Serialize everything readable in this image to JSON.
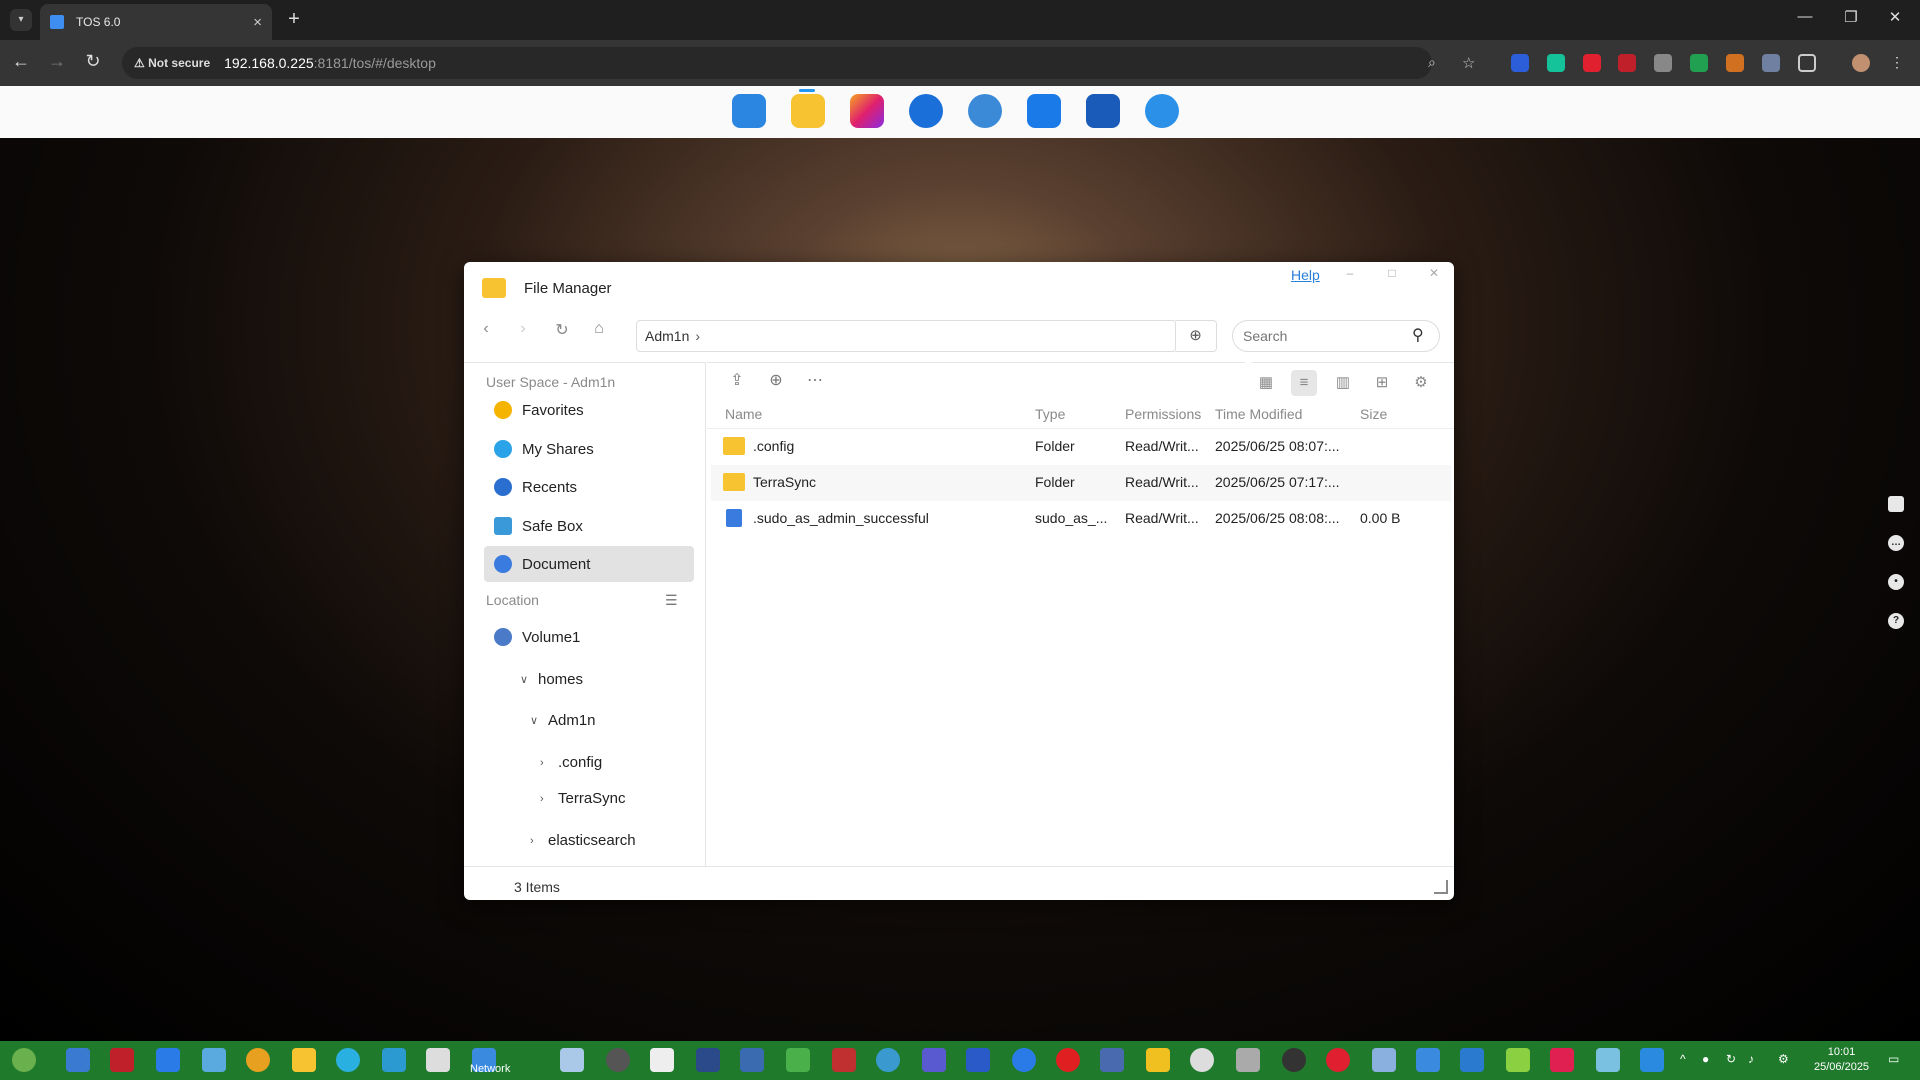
{
  "browser": {
    "tab_title": "TOS 6.0",
    "tab_close": "×",
    "new_tab": "+",
    "security_label": "Not secure",
    "url_host": "192.168.0.225",
    "url_path": ":8181/tos/#/desktop"
  },
  "window": {
    "title": "File Manager",
    "help_label": "Help",
    "breadcrumb": "Adm1n",
    "search_placeholder": "Search"
  },
  "sidebar": {
    "section_user": "User Space - Adm1n",
    "items": [
      {
        "label": "Favorites",
        "icon": "star-icon",
        "color": "#f5b400"
      },
      {
        "label": "My Shares",
        "icon": "share-icon",
        "color": "#2aa3e8"
      },
      {
        "label": "Recents",
        "icon": "clock-icon",
        "color": "#2a6fd0"
      },
      {
        "label": "Safe Box",
        "icon": "box-icon",
        "color": "#3a9ad9"
      },
      {
        "label": "Document",
        "icon": "document-icon",
        "color": "#3a7be0"
      }
    ],
    "section_location": "Location",
    "tree": {
      "volume": "Volume1",
      "homes": "homes",
      "user": "Adm1n",
      "config": ".config",
      "terrasync": "TerraSync",
      "elasticsearch": "elasticsearch"
    }
  },
  "table": {
    "columns": {
      "name": "Name",
      "type": "Type",
      "permissions": "Permissions",
      "modified": "Time Modified",
      "size": "Size"
    },
    "rows": [
      {
        "name": ".config",
        "type": "Folder",
        "permissions": "Read/Writ...",
        "modified": "2025/06/25 08:07:...",
        "size": ""
      },
      {
        "name": "TerraSync",
        "type": "Folder",
        "permissions": "Read/Writ...",
        "modified": "2025/06/25 07:17:...",
        "size": ""
      },
      {
        "name": ".sudo_as_admin_successful",
        "type": "sudo_as_...",
        "permissions": "Read/Writ...",
        "modified": "2025/06/25 08:08:...",
        "size": "0.00 B"
      }
    ]
  },
  "status": {
    "items": "3 Items"
  },
  "taskbar": {
    "network_label": "Network",
    "clock_time": "10:01",
    "clock_date": "25/06/2025"
  },
  "colors": {
    "folder": "#f7c330",
    "accent": "#2196f3",
    "taskbar": "#1f7a2c"
  }
}
